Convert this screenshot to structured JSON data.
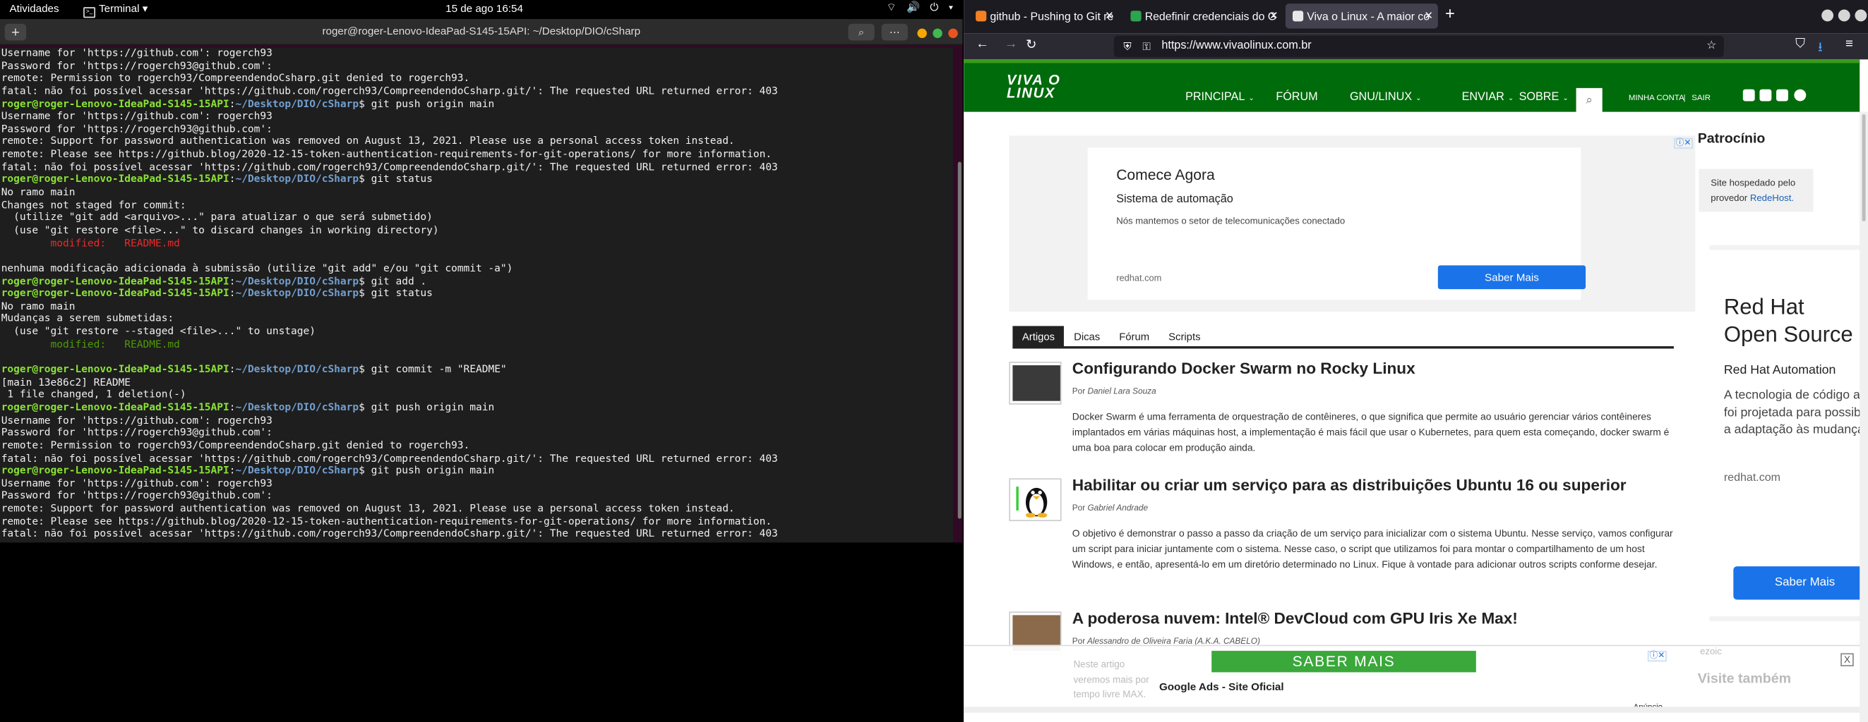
{
  "topbar": {
    "activities": "Atividades",
    "app_name": "Terminal",
    "app_caret": "▾",
    "clock": "15 de ago  16:54",
    "tray": "⌔ 🔊 ⏻ ▾"
  },
  "terminal": {
    "title": "roger@roger-Lenovo-IdeaPad-S145-15API: ~/Desktop/DIO/cSharp",
    "new_tab": "+",
    "search_icon": "⌕",
    "menu_icon": "⋯",
    "prompt_user": "roger@roger-Lenovo-IdeaPad-S145-15API",
    "prompt_dir": "~/Desktop/DIO/cSharp",
    "lines": [
      {
        "t": "Username for 'https://github.com': rogerch93"
      },
      {
        "t": "Password for 'https://rogerch93@github.com':"
      },
      {
        "t": "remote: Permission to rogerch93/CompreendendoCsharp.git denied to rogerch93."
      },
      {
        "t": "fatal: não foi possível acessar 'https://github.com/rogerch93/CompreendendoCsharp.git/': The requested URL returned error: 403"
      },
      {
        "cmd": "git push origin main"
      },
      {
        "t": "Username for 'https://github.com': rogerch93"
      },
      {
        "t": "Password for 'https://rogerch93@github.com':"
      },
      {
        "t": "remote: Support for password authentication was removed on August 13, 2021. Please use a personal access token instead."
      },
      {
        "t": "remote: Please see https://github.blog/2020-12-15-token-authentication-requirements-for-git-operations/ for more information."
      },
      {
        "t": "fatal: não foi possível acessar 'https://github.com/rogerch93/CompreendendoCsharp.git/': The requested URL returned error: 403"
      },
      {
        "cmd": "git status"
      },
      {
        "t": "No ramo main"
      },
      {
        "t": "Changes not staged for commit:"
      },
      {
        "t": "  (utilize \"git add <arquivo>...\" para atualizar o que será submetido)"
      },
      {
        "t": "  (use \"git restore <file>...\" to discard changes in working directory)"
      },
      {
        "t": "        modified:   README.md",
        "c": "red"
      },
      {
        "t": ""
      },
      {
        "t": "nenhuma modificação adicionada à submissão (utilize \"git add\" e/ou \"git commit -a\")"
      },
      {
        "cmd": "git add ."
      },
      {
        "cmd": "git status"
      },
      {
        "t": "No ramo main"
      },
      {
        "t": "Mudanças a serem submetidas:"
      },
      {
        "t": "  (use \"git restore --staged <file>...\" to unstage)"
      },
      {
        "t": "        modified:   README.md",
        "c": "grn"
      },
      {
        "t": ""
      },
      {
        "cmd": "git commit -m \"README\""
      },
      {
        "t": "[main 13e86c2] README"
      },
      {
        "t": " 1 file changed, 1 deletion(-)"
      },
      {
        "cmd": "git push origin main"
      },
      {
        "t": "Username for 'https://github.com': rogerch93"
      },
      {
        "t": "Password for 'https://rogerch93@github.com':"
      },
      {
        "t": "remote: Permission to rogerch93/CompreendendoCsharp.git denied to rogerch93."
      },
      {
        "t": "fatal: não foi possível acessar 'https://github.com/rogerch93/CompreendendoCsharp.git/': The requested URL returned error: 403"
      },
      {
        "cmd": "git push origin main"
      },
      {
        "t": "Username for 'https://github.com': rogerch93"
      },
      {
        "t": "Password for 'https://rogerch93@github.com':"
      },
      {
        "t": "remote: Support for password authentication was removed on August 13, 2021. Please use a personal access token instead."
      },
      {
        "t": "remote: Please see https://github.blog/2020-12-15-token-authentication-requirements-for-git-operations/ for more information."
      },
      {
        "t": "fatal: não foi possível acessar 'https://github.com/rogerch93/CompreendendoCsharp.git/': The requested URL returned error: 403"
      }
    ]
  },
  "browser": {
    "tabs": [
      {
        "label": "github - Pushing to Git re",
        "fav_color": "#f48024"
      },
      {
        "label": "Redefinir credenciais do G",
        "fav_color": "#2ea44f"
      },
      {
        "label": "Viva o Linux - A maior co",
        "fav_color": "#e8e8e8"
      }
    ],
    "new_tab": "+",
    "url": "https://www.vivaolinux.com.br",
    "nav": {
      "back": "←",
      "forward": "→",
      "reload": "↻",
      "shield": "⛨",
      "lock": "🔒",
      "star": "☆",
      "pocket": "⛉",
      "download": "⭳",
      "menu": "≡"
    }
  },
  "site": {
    "logo_line1": "VIVA O",
    "logo_line2": "LINUX",
    "menu": [
      "PRINCIPAL",
      "FÓRUM",
      "GNU/LINUX",
      "ENVIAR",
      "SOBRE"
    ],
    "menu_caret": "⌄",
    "search_icon": "⌕",
    "account": "MINHA CONTA",
    "separator": "|",
    "logout": "SAIR",
    "social": [
      "rss-icon",
      "facebook-icon",
      "twitter-icon",
      "telegram-icon"
    ],
    "ad_top": {
      "headline": "Comece Agora",
      "subhead": "Sistema de automação",
      "desc": "Nós mantemos o setor de telecomunicações conectado",
      "source": "redhat.com",
      "cta": "Saber Mais",
      "choice": "ⓘ✕"
    },
    "content_tabs": [
      "Artigos",
      "Dicas",
      "Fórum",
      "Scripts"
    ],
    "articles": [
      {
        "title": "Configurando Docker Swarm no Rocky Linux",
        "by_label": "Por",
        "author": "Daniel Lara Souza",
        "excerpt": "Docker Swarm é uma ferramenta de orquestração de contêineres, o que significa que permite ao usuário gerenciar vários contêineres implantados em várias máquinas host, a implementação é mais fácil que usar o Kubernetes, para quem esta começando, docker swarm é uma boa para colocar em produção ainda.",
        "thumb": "#3a3a3a"
      },
      {
        "title": "Habilitar ou criar um serviço para as distribuições Ubuntu 16 ou superior",
        "by_label": "Por",
        "author": "Gabriel Andrade",
        "excerpt": "O objetivo é demonstrar o passo a passo da criação de um serviço para inicializar com o sistema Ubuntu. Nesse serviço, vamos configurar um script para iniciar juntamente com o sistema. Nesse caso, o script que utilizamos foi para montar o compartilhamento de um host Windows, e então, apresentá-lo em um diretório determinado no Linux. Fique à vontade para adicionar outros scripts conforme desejar.",
        "thumb": "#f0c040"
      },
      {
        "title": "A poderosa nuvem: Intel® DevCloud com GPU Iris Xe Max!",
        "by_label": "Por",
        "author": "Alessandro de Oliveira Faria (A.K.A. CABELO)",
        "excerpt": "",
        "thumb": "#8a6a4a"
      }
    ],
    "sidebar": {
      "title": "Patrocínio",
      "host_text": "Site hospedado pelo provedor",
      "host_link": "RedeHost.",
      "ad_title1": "Red Hat",
      "ad_title2": "Open Source",
      "ad_sub": "Red Hat Automation",
      "ad_desc": "A tecnologia de código aberto foi projetada para possibilitar a adaptação às mudanças",
      "ad_source": "redhat.com",
      "ad_cta": "Saber Mais"
    },
    "bottom_ad": {
      "faded": "Neste artigo veremos mais por tempo livre MAX.",
      "cta": "SABER MAIS",
      "label": "Google Ads - Site Oficial",
      "anuncio": "Anúncio",
      "close": "X",
      "ezoic": "ezoic",
      "visite": "Visite também"
    }
  }
}
